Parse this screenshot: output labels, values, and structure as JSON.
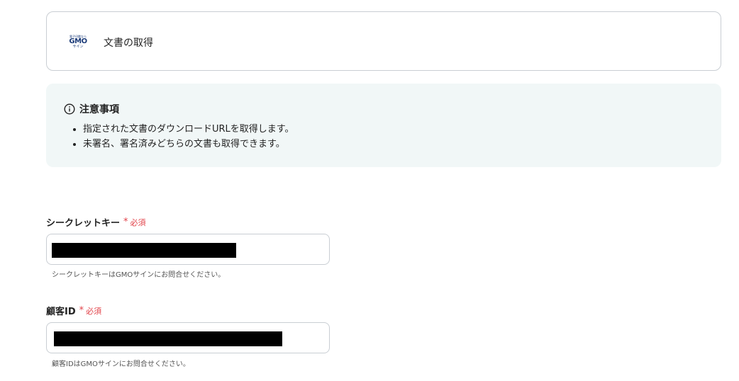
{
  "action": {
    "logo": {
      "top": "電子印鑑なら",
      "brand": "GMO",
      "bottom": "サイン"
    },
    "title": "文書の取得"
  },
  "notice": {
    "title": "注意事項",
    "items": [
      "指定された文書のダウンロードURLを取得します。",
      "未署名、署名済みどちらの文書も取得できます。"
    ]
  },
  "fields": [
    {
      "label": "シークレットキー",
      "required_mark": "*",
      "required_text": "必須",
      "help": "シークレットキーはGMOサインにお問合せください。"
    },
    {
      "label": "顧客ID",
      "required_mark": "*",
      "required_text": "必須",
      "help": "顧客IDはGMOサインにお問合せください。"
    }
  ],
  "colors": {
    "accent_required": "#e2434a",
    "notice_bg": "#f1f7f7",
    "border": "#c9ced3"
  }
}
